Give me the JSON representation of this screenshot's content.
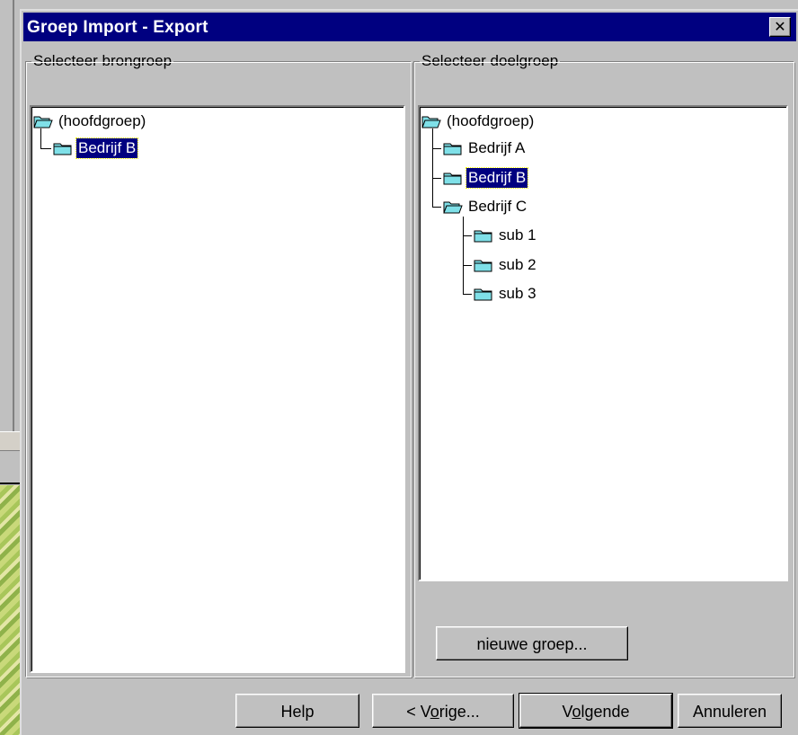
{
  "dialog": {
    "title": "Groep Import - Export",
    "close_glyph": "✕"
  },
  "source": {
    "legend": "Selecteer brongroep",
    "root_label": "(hoofdgroep)",
    "items": [
      {
        "label": "Bedrijf B",
        "selected": true
      }
    ]
  },
  "target": {
    "legend": "Selecteer doelgroep",
    "root_label": "(hoofdgroep)",
    "items": [
      {
        "label": "Bedrijf A"
      },
      {
        "label": "Bedrijf B",
        "selected": true
      },
      {
        "label": "Bedrijf C",
        "expanded": true
      },
      {
        "label": "sub 1"
      },
      {
        "label": "sub 2"
      },
      {
        "label": "sub 3"
      }
    ],
    "new_group_button": "nieuwe groep..."
  },
  "buttons": {
    "help": "Help",
    "prev_pre": "< V",
    "prev_u": "o",
    "prev_post": "rige...",
    "next_pre": "V",
    "next_u": "o",
    "next_post": "lgende",
    "cancel": "Annuleren"
  },
  "icons": {
    "folder_closed": "folder-closed-icon",
    "folder_open": "folder-open-icon",
    "close": "close-icon"
  },
  "colors": {
    "titlebar": "#000080",
    "selection": "#000080",
    "face": "#c0c0c0",
    "folder": "#7fe0e8"
  }
}
